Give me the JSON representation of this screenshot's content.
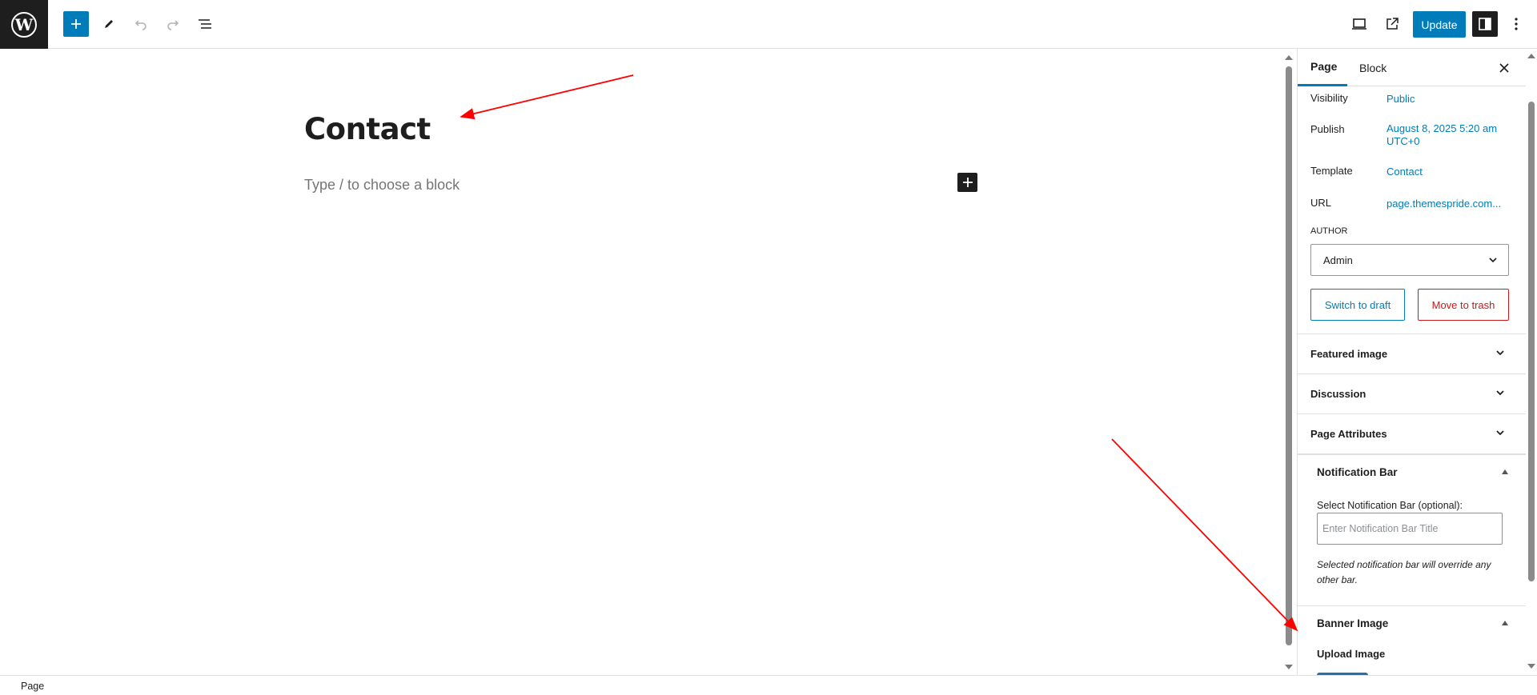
{
  "topbar": {
    "icons": [
      "wordpress-logo",
      "plus-icon",
      "pencil-icon",
      "undo-icon",
      "redo-icon",
      "list-view-icon",
      "desktop-preview-icon",
      "external-link-icon",
      "sidebar-toggle-icon",
      "more-vertical-icon"
    ],
    "update_label": "Update"
  },
  "editor": {
    "title": "Contact",
    "placeholder": "Type / to choose a block"
  },
  "sidebar": {
    "tabs": [
      "Page",
      "Block"
    ],
    "summary": [
      {
        "label": "Visibility",
        "value": "Public"
      },
      {
        "label": "Publish",
        "value": "August 8, 2025 5:20 am UTC+0"
      },
      {
        "label": "Template",
        "value": "Contact"
      },
      {
        "label": "URL",
        "value": "page.themespride.com..."
      }
    ],
    "author_label": "AUTHOR",
    "author_value": "Admin",
    "switch_draft": "Switch to draft",
    "move_trash": "Move to trash",
    "panels": [
      "Featured image",
      "Discussion",
      "Page Attributes"
    ],
    "notification_bar": {
      "title": "Notification Bar",
      "select_label": "Select Notification Bar (optional):",
      "placeholder": "Enter Notification Bar Title",
      "help": "Selected notification bar will override any other bar."
    },
    "banner_image": {
      "title": "Banner Image",
      "upload_label": "Upload Image"
    }
  },
  "footer": {
    "breadcrumb": "Page"
  },
  "colors": {
    "accent": "#007cba",
    "danger": "#cc1818",
    "dark": "#1e1e1e",
    "annotation": "#ff0000"
  }
}
